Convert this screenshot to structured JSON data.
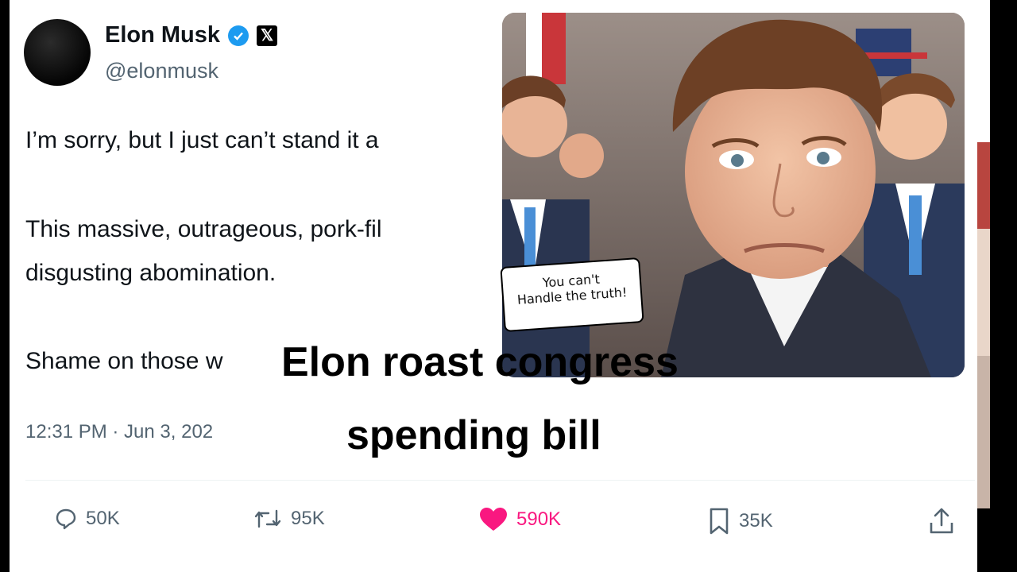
{
  "author": {
    "name": "Elon Musk",
    "handle": "@elonmusk",
    "x_logo": "𝕏"
  },
  "tweet": {
    "line1": "I’m sorry, but I just can’t stand it a",
    "line2": "This massive, outrageous, pork-fil",
    "line3": "disgusting abomination.",
    "line4": "Shame on those w",
    "timestamp": "12:31 PM · Jun 3, 202"
  },
  "overlay": {
    "title_line1": "Elon roast congress",
    "title_line2": "spending bill",
    "bubble_line1": "You can't",
    "bubble_line2": "Handle the truth!"
  },
  "actions": {
    "replies": "50K",
    "reposts": "95K",
    "likes": "590K",
    "bookmarks": "35K"
  },
  "colors": {
    "verified": "#1d9bf0",
    "like": "#f91880",
    "muted": "#536471"
  },
  "icons": [
    "verified-badge-icon",
    "x-logo-icon",
    "reply-icon",
    "repost-icon",
    "like-icon",
    "bookmark-icon",
    "share-icon"
  ]
}
